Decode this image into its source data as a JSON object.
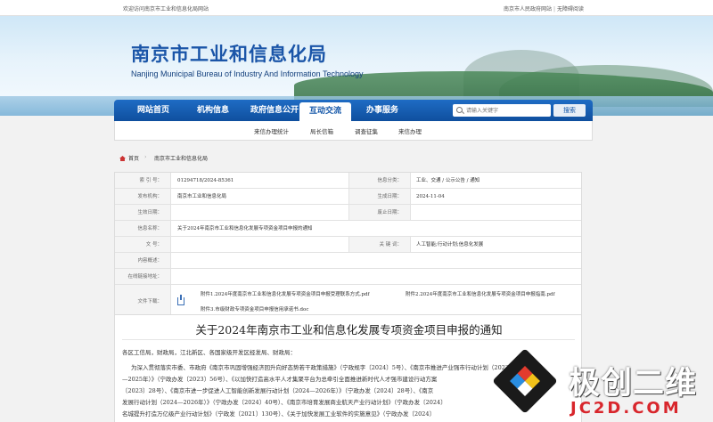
{
  "topbar": {
    "welcome": "欢迎访问南京市工业和信息化局网站",
    "link_gov": "南京市人民政府网站",
    "link_accessible": "无障碍阅读"
  },
  "banner": {
    "title_cn": "南京市工业和信息化局",
    "title_en": "Nanjing Municipal Bureau of Industry And Information Technology"
  },
  "nav": {
    "items": [
      {
        "label": "网站首页"
      },
      {
        "label": "机构信息"
      },
      {
        "label": "政府信息公开"
      },
      {
        "label": "互动交流"
      },
      {
        "label": "办事服务"
      }
    ],
    "active_index": 3,
    "search_placeholder": "请输入关键字",
    "search_button": "搜索"
  },
  "subnav": {
    "items": [
      "来信办理统计",
      "局长信箱",
      "调查征集",
      "来信办理"
    ]
  },
  "breadcrumb": {
    "home": "首页",
    "current": "南京市工业和信息化局"
  },
  "info": {
    "index_label": "索  引  号：",
    "index_value": "01294718/2024-85361",
    "category_label": "信息分类：",
    "category_value": "工业、交通 / 公示公告 / 通知",
    "issuer_label": "发布机构：",
    "issuer_value": "南京市工业和信息化局",
    "date_label": "生成日期：",
    "date_value": "2024-11-04",
    "effective_label": "生效日期：",
    "effective_value": "",
    "expiry_label": "废止日期：",
    "expiry_value": "",
    "name_label": "信息名称：",
    "name_value": "关于2024年南京市工业和信息化发展专项资金项目申报的通知",
    "docno_label": "文      号：",
    "docno_value": "",
    "keywords_label": "关  键  词：",
    "keywords_value": "人工智能;行动计划;信息化发展",
    "summary_label": "内容概述：",
    "summary_value": "",
    "link_label": "在线链接地址：",
    "link_value": "",
    "files_label": "文件下载：",
    "files": [
      "附件1.2024年度南京市工业和信息化发展专项资金项目申报受理联系方式.pdf",
      "附件2.2024年度南京市工业和信息化发展专项资金项目申报指南.pdf",
      "附件3.市级财政专项资金项目申报信用承诺书.doc"
    ]
  },
  "article": {
    "title": "关于2024年南京市工业和信息化发展专项资金项目申报的通知",
    "greeting": "各区工信局，财政局，江北新区、各国家级开发区经发局、财政局：",
    "lines": [
      "为深入贯彻落实市委、市政府《南京市巩固增强经济回升向好态势若干政策措施》（宁政规字〔2024〕5号）、《南京市推进产业强市行动计划（2023",
      "—2025年）》（宁政办发〔2023〕56号）、《以加快打造高水平人才集聚平台为总牵引全面推进新时代人才强市建设行动方案",
      "〔2023〕28号）、《南京市进一步促进人工智能创新发展行动计划（2024—2026年）》（宁政办发〔2024〕28号）、《南京",
      "发展行动计划（2024—2026年）》（宁政办发〔2024〕40号）、《南京市培育发展商业航天产业行动计划》（宁政办发〔2024〕",
      "名城提升打造万亿级产业行动计划》（宁政发〔2021〕130号）、《关于加快发展工业软件的实施意见》（宁政办发〔2024〕"
    ]
  },
  "watermark": {
    "title": "极创二维",
    "site": "JC2D.COM"
  }
}
